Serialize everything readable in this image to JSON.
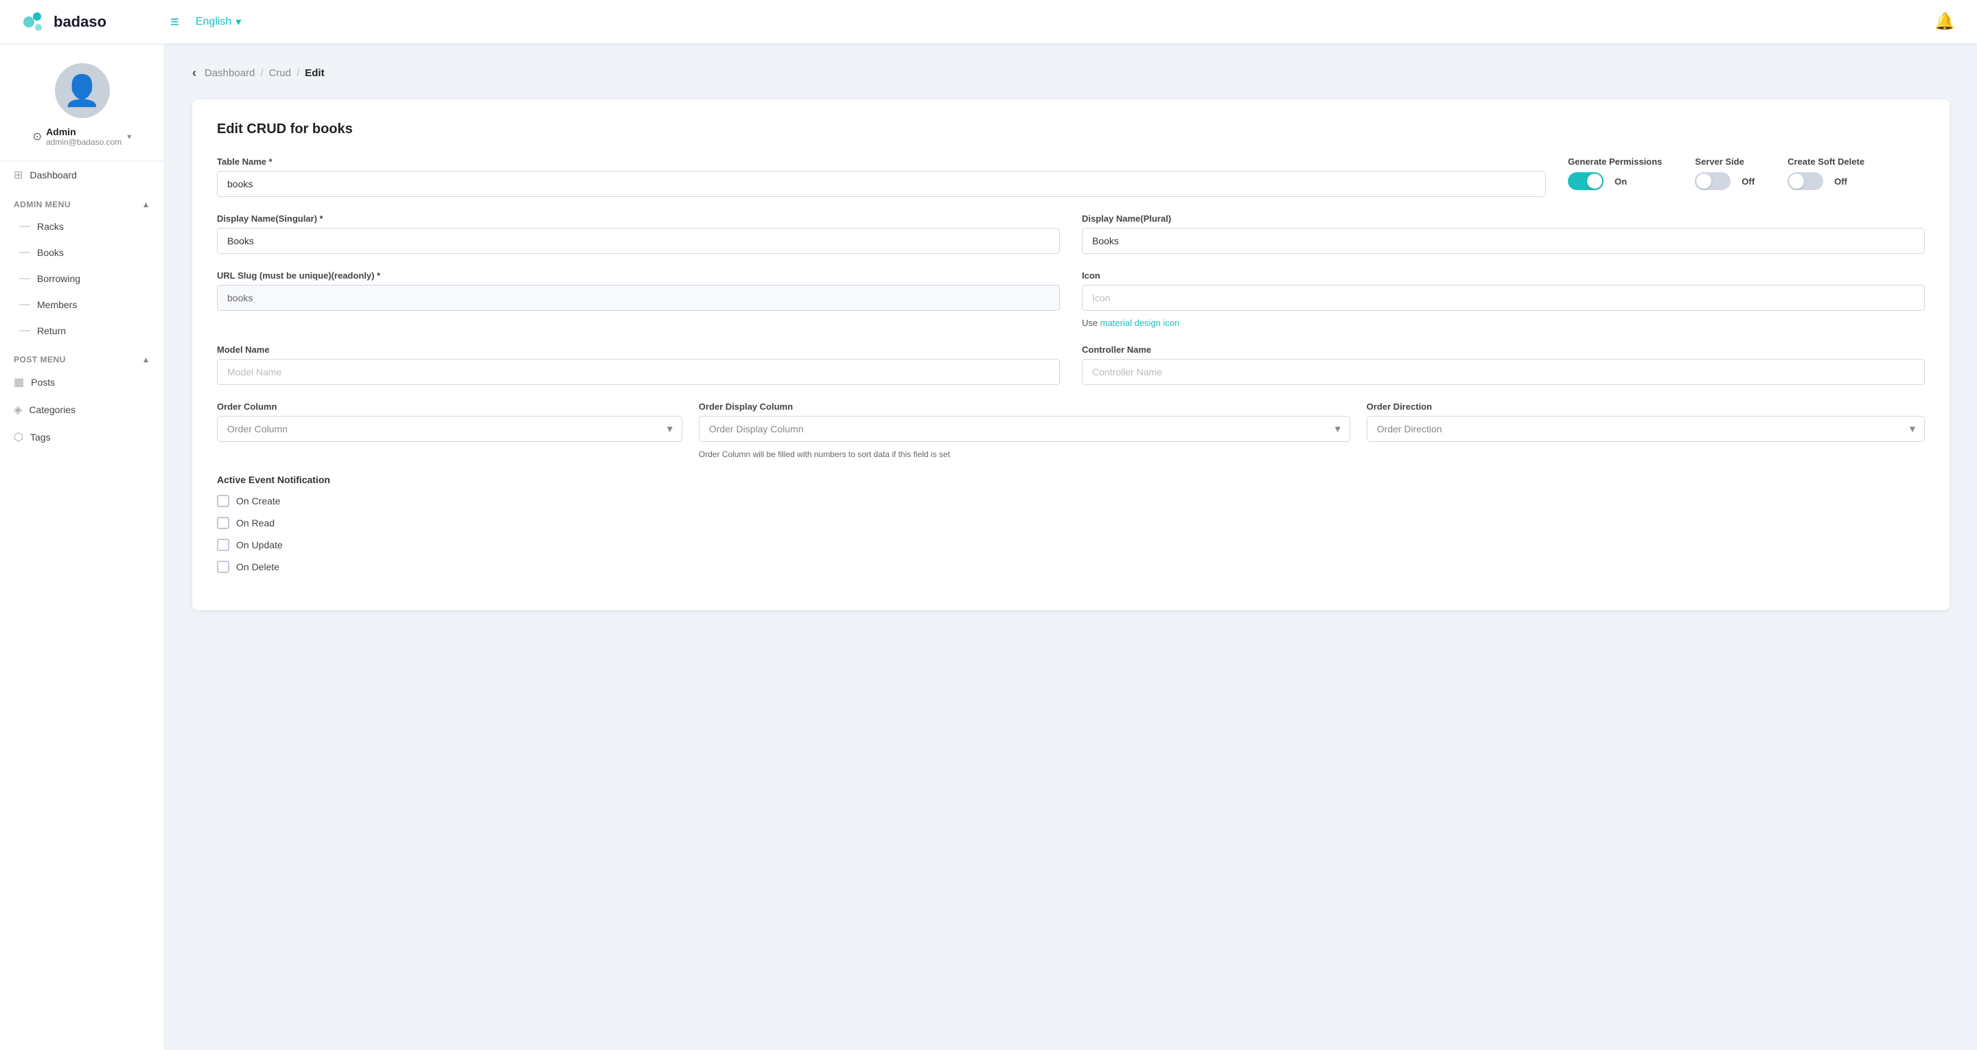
{
  "header": {
    "logo_text": "badaso",
    "lang_label": "English",
    "lang_arrow": "▾",
    "hamburger": "≡",
    "notification_count": "0"
  },
  "sidebar": {
    "user": {
      "name": "Admin",
      "email": "admin@badaso.com",
      "chevron": "▾"
    },
    "dashboard_label": "Dashboard",
    "admin_menu_label": "Admin Menu",
    "admin_menu_chevron": "▲",
    "admin_items": [
      {
        "label": "Racks"
      },
      {
        "label": "Books"
      },
      {
        "label": "Borrowing"
      },
      {
        "label": "Members"
      },
      {
        "label": "Return"
      }
    ],
    "post_menu_label": "Post Menu",
    "post_menu_chevron": "▲",
    "post_items": [
      {
        "label": "Posts",
        "icon": "▦"
      },
      {
        "label": "Categories",
        "icon": "◈"
      },
      {
        "label": "Tags",
        "icon": "⬡"
      }
    ]
  },
  "breadcrumb": {
    "back": "‹",
    "dashboard": "Dashboard",
    "sep1": "/",
    "crud": "Crud",
    "sep2": "/",
    "current": "Edit"
  },
  "card": {
    "title": "Edit CRUD for books"
  },
  "form": {
    "table_name_label": "Table Name *",
    "table_name_value": "books",
    "generate_permissions_label": "Generate Permissions",
    "generate_permissions_state": "On",
    "generate_permissions_on": true,
    "server_side_label": "Server Side",
    "server_side_state": "Off",
    "server_side_on": false,
    "create_soft_delete_label": "Create Soft Delete",
    "create_soft_delete_state": "Off",
    "create_soft_delete_on": false,
    "display_name_singular_label": "Display Name(Singular) *",
    "display_name_singular_value": "Books",
    "display_name_plural_label": "Display Name(Plural)",
    "display_name_plural_value": "Books",
    "url_slug_label": "URL Slug (must be unique)(readonly) *",
    "url_slug_value": "books",
    "icon_label": "Icon",
    "icon_placeholder": "Icon",
    "icon_helper_text": "Use",
    "icon_helper_link": "material design icon",
    "model_name_label": "Model Name",
    "model_name_placeholder": "Model Name",
    "controller_name_label": "Controller Name",
    "controller_name_placeholder": "Controller Name",
    "order_column_label": "Order Column",
    "order_column_placeholder": "Order Column",
    "order_display_column_label": "Order Display Column",
    "order_display_column_placeholder": "Order Display Column",
    "order_direction_label": "Order Direction",
    "order_direction_placeholder": "Order Direction",
    "order_helper_text": "Order Column will be filled with numbers to sort data if this field is set",
    "event_notification_label": "Active Event Notification",
    "checkboxes": [
      {
        "label": "On Create",
        "checked": false
      },
      {
        "label": "On Read",
        "checked": false
      },
      {
        "label": "On Update",
        "checked": false
      },
      {
        "label": "On Delete",
        "checked": false
      }
    ]
  }
}
